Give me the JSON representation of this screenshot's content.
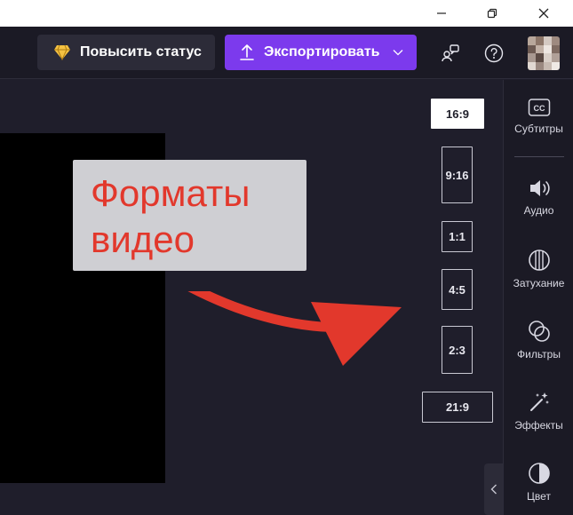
{
  "window": {
    "minimize_icon": "minimize-icon",
    "restore_icon": "restore-icon",
    "close_icon": "close-icon"
  },
  "toolbar": {
    "premium_label": "Повысить статус",
    "export_label": "Экспортировать",
    "accent_color": "#7c3aed"
  },
  "aspect_ratios": {
    "r16_9": "16:9",
    "r9_16": "9:16",
    "r1_1": "1:1",
    "r4_5": "4:5",
    "r2_3": "2:3",
    "r21_9": "21:9",
    "selected": "16:9"
  },
  "callout": {
    "line1": "Форматы",
    "line2": "видео"
  },
  "sidebar": {
    "subtitles": "Субтитры",
    "audio": "Аудио",
    "fade": "Затухание",
    "filters": "Фильтры",
    "effects": "Эффекты",
    "color": "Цвет"
  }
}
